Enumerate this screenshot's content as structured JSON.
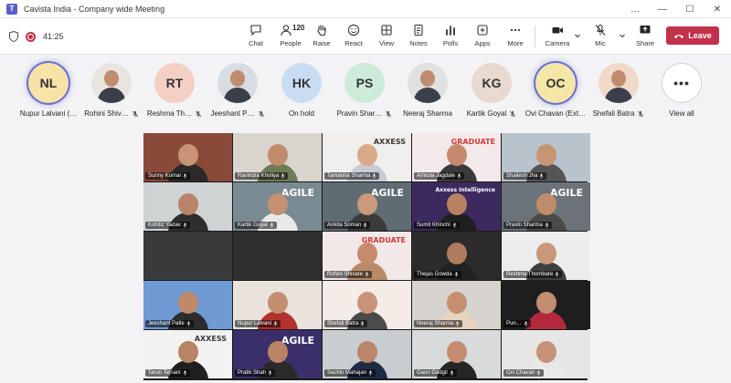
{
  "window": {
    "title": "Cavista India - Company wide Meeting",
    "controls": [
      "…",
      "—",
      "☐",
      "✕"
    ]
  },
  "toolbar": {
    "timer": "41:25",
    "people_count": "120",
    "buttons": {
      "chat": "Chat",
      "people": "People",
      "raise": "Raise",
      "react": "React",
      "view": "View",
      "notes": "Notes",
      "polls": "Polls",
      "apps": "Apps",
      "more": "More",
      "camera": "Camera",
      "mic": "Mic",
      "share": "Share"
    },
    "leave_label": "Leave",
    "colors": {
      "leave": "#c4314b",
      "accent": "#5b5fc7"
    }
  },
  "strip": [
    {
      "name": "Nupur Lalvani (…",
      "initials": "NL",
      "kind": "initials",
      "ring": true,
      "muted": false,
      "bg": "#f7e3a8"
    },
    {
      "name": "Rohini Shiv…",
      "initials": "",
      "kind": "photo",
      "ring": false,
      "muted": true,
      "bg": "#e9e4df"
    },
    {
      "name": "Reshma Th…",
      "initials": "RT",
      "kind": "initials",
      "ring": false,
      "muted": true,
      "bg": "#f4cfc4"
    },
    {
      "name": "Jeeshant P…",
      "initials": "",
      "kind": "photo",
      "ring": false,
      "muted": true,
      "bg": "#d8dde3"
    },
    {
      "name": "On hold",
      "initials": "HK",
      "kind": "initials",
      "ring": false,
      "muted": false,
      "bg": "#c9ddf2"
    },
    {
      "name": "Pravin Shar…",
      "initials": "PS",
      "kind": "initials",
      "ring": false,
      "muted": true,
      "bg": "#cdebd9"
    },
    {
      "name": "Neeraj Sharma",
      "initials": "",
      "kind": "photo",
      "ring": false,
      "muted": false,
      "bg": "#e1e1e1"
    },
    {
      "name": "Kartik Goyal",
      "initials": "KG",
      "kind": "initials",
      "ring": false,
      "muted": true,
      "bg": "#ead9cf"
    },
    {
      "name": "Ovi Chavan (Ext…",
      "initials": "OC",
      "kind": "initials",
      "ring": true,
      "muted": false,
      "bg": "#f3e6a6"
    },
    {
      "name": "Shefali Batra",
      "initials": "",
      "kind": "photo",
      "ring": false,
      "muted": true,
      "bg": "#f0d9c8"
    },
    {
      "name": "View all",
      "initials": "",
      "kind": "more",
      "ring": false,
      "muted": false,
      "bg": "#ffffff"
    }
  ],
  "tiles": [
    {
      "name": "Sunny Kumar",
      "bg": "#8a4a3a",
      "skin": "#c99476",
      "shirt": "#2a2a2a",
      "banner": ""
    },
    {
      "name": "Ravindra Kholiya",
      "bg": "#d9d4cc",
      "skin": "#c08c6c",
      "shirt": "#6d7b57",
      "banner": ""
    },
    {
      "name": "Tamanna Sharma",
      "bg": "#f1efee",
      "skin": "#d9a98a",
      "shirt": "#c7cbd2",
      "banner": "AXXESS"
    },
    {
      "name": "Amruta Jagdale",
      "bg": "#f4e9ea",
      "skin": "#c48a6d",
      "shirt": "#3a3a3a",
      "banner": "GRADUATE"
    },
    {
      "name": "Shailesh Jha",
      "bg": "#b9c3cc",
      "skin": "#c69575",
      "shirt": "#555555",
      "banner": ""
    },
    {
      "name": "Kshitiz Yadav",
      "bg": "#cfd3d4",
      "skin": "#b98468",
      "shirt": "#2e2e2e",
      "banner": ""
    },
    {
      "name": "Kartik Goyal",
      "bg": "#7a8a93",
      "skin": "#c49272",
      "shirt": "#e9e9e9",
      "banner": "AGILE"
    },
    {
      "name": "Ankita Soman",
      "bg": "#5f6c73",
      "skin": "#c99a7c",
      "shirt": "#3b3b3b",
      "banner": "AGILE"
    },
    {
      "name": "Sumit Khinchi",
      "bg": "#3c2a5e",
      "skin": "#b98262",
      "shirt": "#1f1f1f",
      "banner": "Axxess Intelligence"
    },
    {
      "name": "Pravin Sharma",
      "bg": "#6b7379",
      "skin": "#bf8c6c",
      "shirt": "#4a4a4a",
      "banner": "AGILE"
    },
    {
      "name": "",
      "bg": "#3a3a3a",
      "skin": "#3a3a3a",
      "shirt": "#3a3a3a",
      "banner": ""
    },
    {
      "name": "",
      "bg": "#2f2f2f",
      "skin": "#2f2f2f",
      "shirt": "#2f2f2f",
      "banner": ""
    },
    {
      "name": "Rohini Shivare",
      "bg": "#f2e8e8",
      "skin": "#c48c6c",
      "shirt": "#b98a66",
      "banner": "GRADUATE"
    },
    {
      "name": "Thejas Gowda",
      "bg": "#2b2b2b",
      "skin": "#b07c5e",
      "shirt": "#222222",
      "banner": ""
    },
    {
      "name": "Reshma Thombare",
      "bg": "#ececec",
      "skin": "#c9987a",
      "shirt": "#3f3f3f",
      "banner": ""
    },
    {
      "name": "Jeeshant Patle",
      "bg": "#6f9ad3",
      "skin": "#bf8a68",
      "shirt": "#2d2d2d",
      "banner": ""
    },
    {
      "name": "Nupur Lalvani",
      "bg": "#e9e3dc",
      "skin": "#c48e70",
      "shirt": "#b3322f",
      "banner": ""
    },
    {
      "name": "Shefali Batra",
      "bg": "#f4ece6",
      "skin": "#c9937a",
      "shirt": "#4b4b4b",
      "banner": ""
    },
    {
      "name": "Neeraj Sharma",
      "bg": "#d7d3ce",
      "skin": "#c58f70",
      "shirt": "#e8d3c0",
      "banner": ""
    },
    {
      "name": "Pun…",
      "bg": "#1e1e1e",
      "skin": "#c08d70",
      "shirt": "#b22a3c",
      "banner": ""
    },
    {
      "name": "Tarun Tejnani",
      "bg": "#f2f2f2",
      "skin": "#b98466",
      "shirt": "#1f1f1f",
      "banner": "AXXESS"
    },
    {
      "name": "Pratik Shah",
      "bg": "#3b2f6a",
      "skin": "#b98466",
      "shirt": "#2a2a2a",
      "banner": "AGILE"
    },
    {
      "name": "Sachin Mahajan",
      "bg": "#c9cdd0",
      "skin": "#b9866a",
      "shirt": "#1e2b44",
      "banner": ""
    },
    {
      "name": "Gauri Gadgil",
      "bg": "#d8dadc",
      "skin": "#c48d6f",
      "shirt": "#252525",
      "banner": ""
    },
    {
      "name": "Ovi Chavan",
      "bg": "#e6e6e6",
      "skin": "#c6937a",
      "shirt": "#e9e9e9",
      "banner": ""
    }
  ]
}
